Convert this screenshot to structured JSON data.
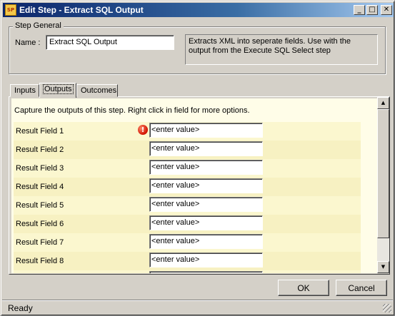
{
  "window": {
    "title": "Edit Step - Extract SQL Output",
    "app_icon_text": "SP",
    "controls": {
      "minimize": "_",
      "maximize": "□",
      "close": "✕"
    }
  },
  "step_general": {
    "legend": "Step General",
    "name_label": "Name :",
    "name_value": "Extract SQL Output",
    "description": "Extracts XML into seperate fields. Use with the output from the Execute SQL Select step"
  },
  "tabs": [
    {
      "label": "Inputs",
      "active": false
    },
    {
      "label": "Outputs",
      "active": true
    },
    {
      "label": "Outcomes",
      "active": false
    }
  ],
  "outputs": {
    "caption": "Capture the outputs of this step.  Right click in field for more options.",
    "error_icon_glyph": "!",
    "rows": [
      {
        "label": "Result Field 1",
        "value": "<enter value>",
        "error": true
      },
      {
        "label": "Result Field 2",
        "value": "<enter value>",
        "error": false
      },
      {
        "label": "Result Field 3",
        "value": "<enter value>",
        "error": false
      },
      {
        "label": "Result Field 4",
        "value": "<enter value>",
        "error": false
      },
      {
        "label": "Result Field 5",
        "value": "<enter value>",
        "error": false
      },
      {
        "label": "Result Field 6",
        "value": "<enter value>",
        "error": false
      },
      {
        "label": "Result Field 7",
        "value": "<enter value>",
        "error": false
      },
      {
        "label": "Result Field 8",
        "value": "<enter value>",
        "error": false
      }
    ]
  },
  "scrollbar": {
    "up_glyph": "▲",
    "down_glyph": "▼"
  },
  "buttons": {
    "ok": "OK",
    "cancel": "Cancel"
  },
  "status": {
    "text": "Ready"
  }
}
